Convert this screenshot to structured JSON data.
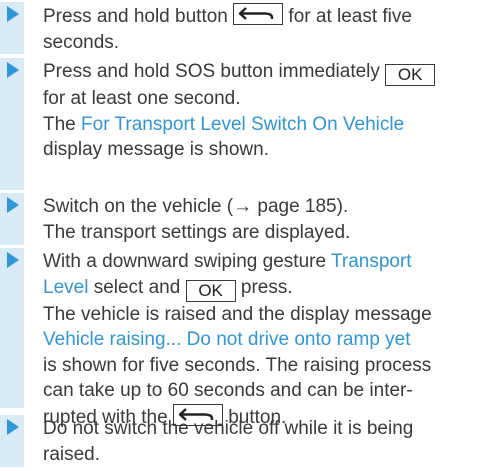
{
  "steps": [
    {
      "pre": "Press and hold button ",
      "key_icon": "back-arrow-icon",
      "post_line1": " for at least five",
      "line2": "seconds."
    },
    {
      "line1_pre": "Press and hold SOS button immediately ",
      "ok_label": "OK",
      "line2": "for at least one second.",
      "result_pre": "The ",
      "result_highlight": "For Transport Level Switch On Vehicle",
      "result_post": "display message is shown."
    },
    {
      "line1": "Switch on the vehicle (→ page 185).",
      "line2": "The transport settings are displayed."
    },
    {
      "line1_pre": "With a downward swiping gesture ",
      "highlight_1": "Transport",
      "highlight_2": "Level",
      "mid": " select and ",
      "ok_label": "OK",
      "post": " press.",
      "r1": "The vehicle is raised and the display message",
      "r2_highlight": "Vehicle raising... Do not drive onto ramp yet",
      "r3": "is shown for five seconds. The raising process",
      "r4": "can take up to 60 seconds and can be inter-",
      "r5_pre": "rupted with the ",
      "r5_key_icon": "back-arrow-icon",
      "r5_post": " button."
    },
    {
      "line1": "Do not switch the vehicle off while it is being",
      "line2": "raised."
    }
  ],
  "colors": {
    "accent": "#2f97d6",
    "bar": "#d7eaf6",
    "text": "#3a3a3a"
  }
}
